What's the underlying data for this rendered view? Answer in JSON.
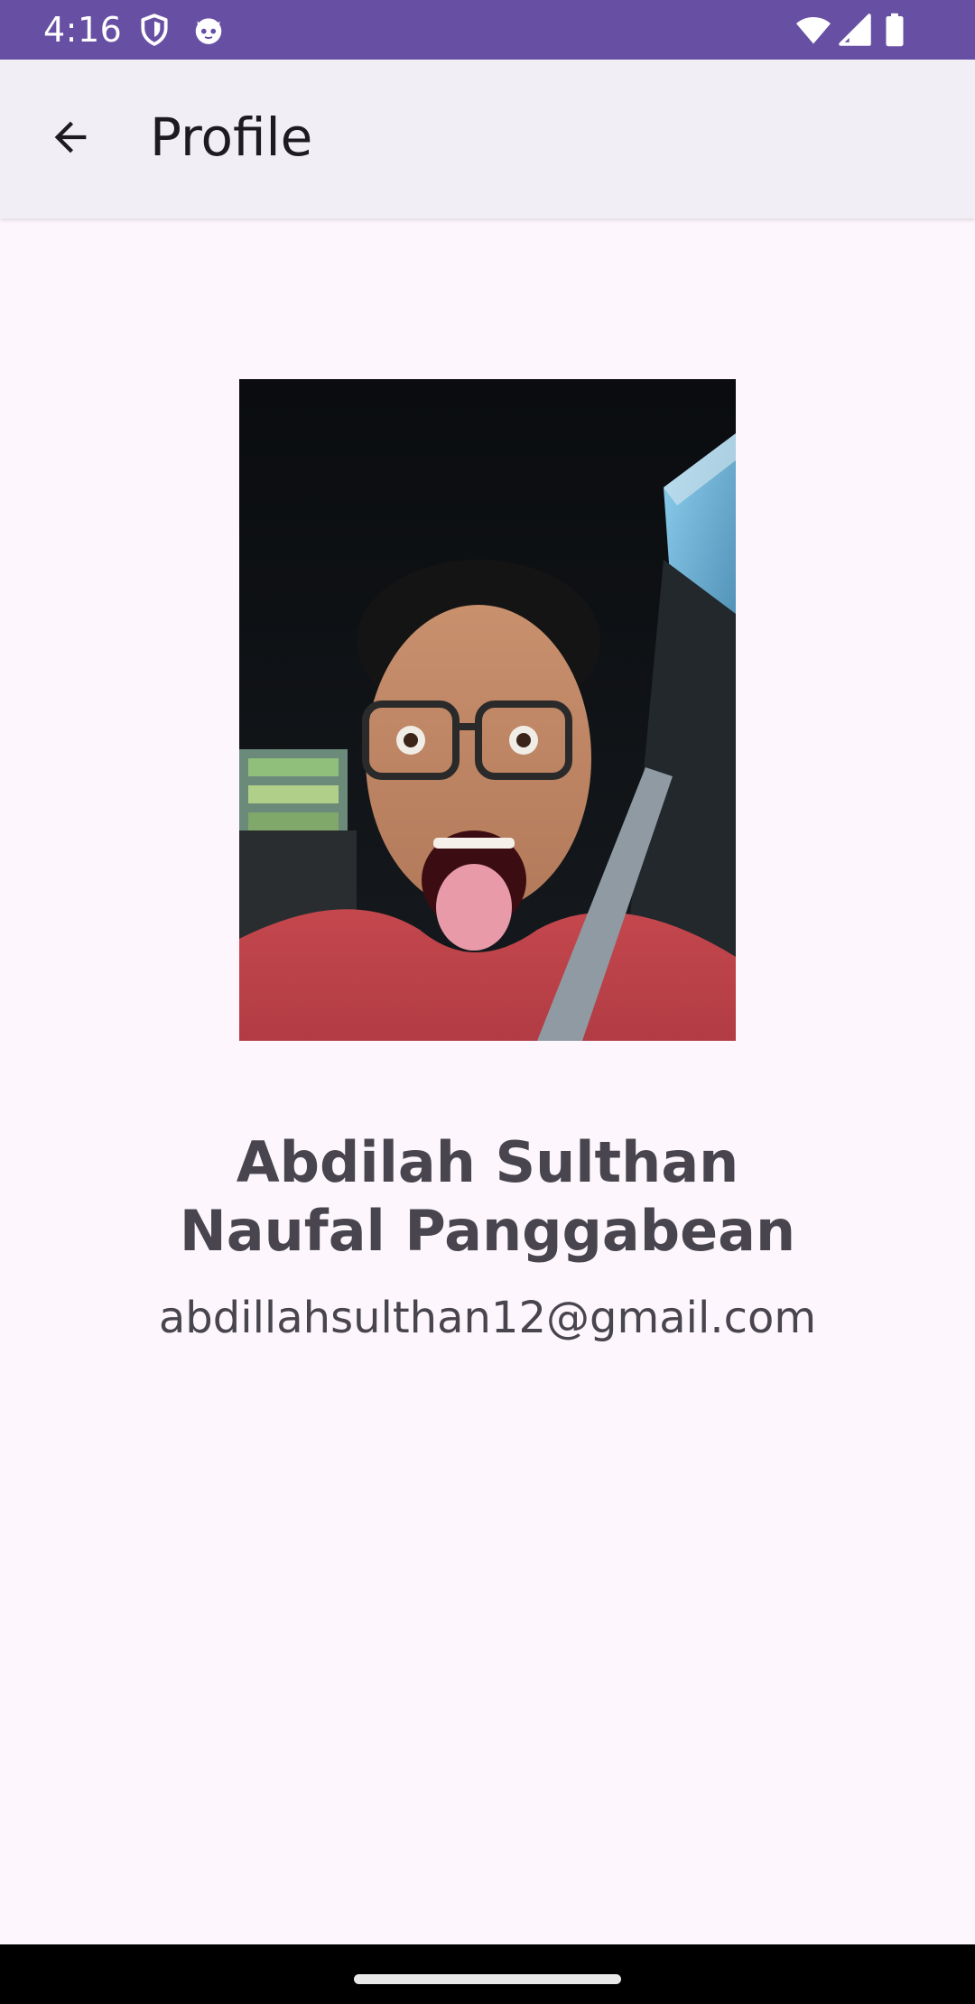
{
  "status_bar": {
    "time": "4:16",
    "left_icons": [
      "shield-icon",
      "cat-face-icon"
    ],
    "right_icons": [
      "wifi-icon",
      "cellular-signal-icon",
      "battery-icon"
    ],
    "background_color": "#6750a4"
  },
  "app_bar": {
    "back_icon": "arrow-back-icon",
    "title": "Profile",
    "background_color": "#f2eef6"
  },
  "profile": {
    "name": "Abdilah Sulthan Naufal Panggabean",
    "email": "abdillahsulthan12@gmail.com",
    "photo_alt": "Profile photo"
  },
  "colors": {
    "page_background": "#fdf7fd",
    "text_primary": "#49454f",
    "title_text": "#1d1b20"
  }
}
